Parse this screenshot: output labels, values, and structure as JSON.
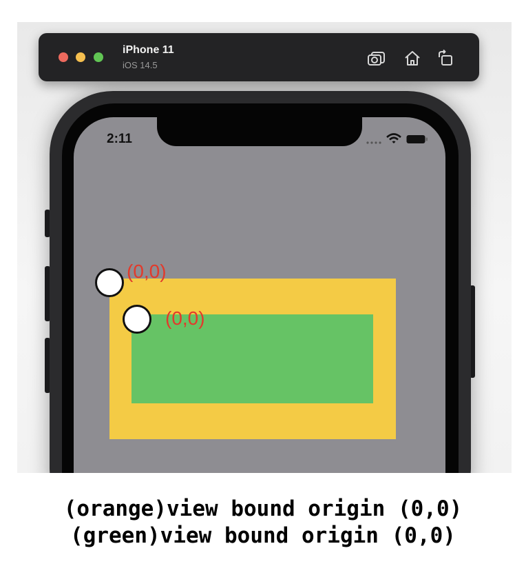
{
  "simulator": {
    "device_name": "iPhone 11",
    "os_version": "iOS 14.5",
    "toolbar_icons": [
      "screenshot-icon",
      "home-icon",
      "rotate-icon"
    ]
  },
  "status_bar": {
    "time": "2:11"
  },
  "views": {
    "orange": {
      "color": "#f4cb45",
      "origin_label": "(0,0)"
    },
    "green": {
      "color": "#66c365",
      "origin_label": "(0,0)"
    }
  },
  "screen_background": "#8e8d92",
  "label_color": "#e23a2b",
  "caption": {
    "line1": "(orange)view bound origin (0,0)",
    "line2": "(green)view bound origin (0,0)"
  }
}
